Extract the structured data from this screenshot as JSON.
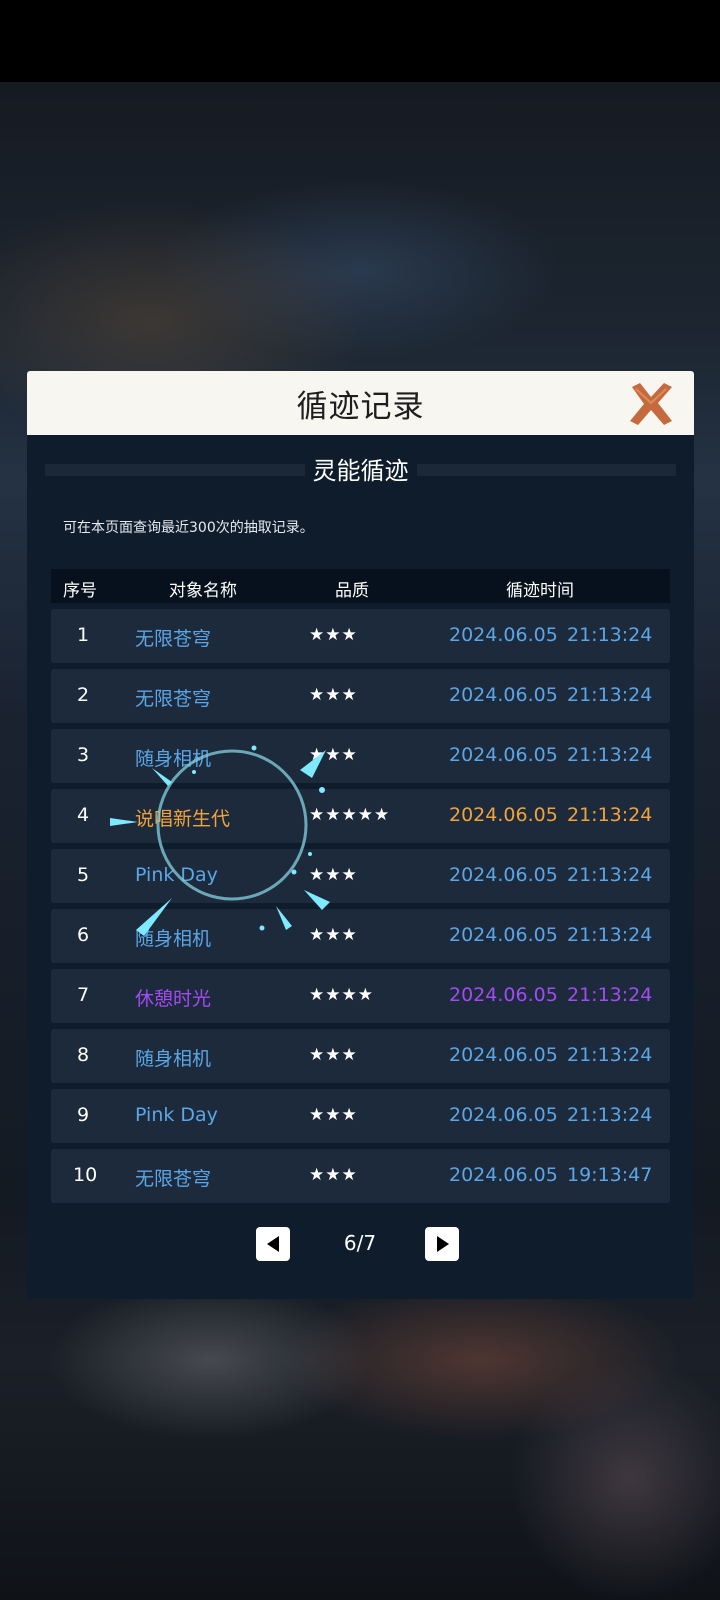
{
  "dialog": {
    "title": "循迹记录",
    "subtitle": "灵能循迹",
    "note": "可在本页面查询最近300次的抽取记录。"
  },
  "table": {
    "headers": {
      "no": "序号",
      "name": "对象名称",
      "quality": "品质",
      "time": "循迹时间"
    },
    "rows": [
      {
        "no": "1",
        "name": "无限苍穹",
        "stars": "★★★",
        "date": "2024.06.05",
        "time": "21:13:24",
        "color": "#5ba6e6"
      },
      {
        "no": "2",
        "name": "无限苍穹",
        "stars": "★★★",
        "date": "2024.06.05",
        "time": "21:13:24",
        "color": "#5ba6e6"
      },
      {
        "no": "3",
        "name": "随身相机",
        "stars": "★★★",
        "date": "2024.06.05",
        "time": "21:13:24",
        "color": "#5ba6e6"
      },
      {
        "no": "4",
        "name": "说唱新生代",
        "stars": "★★★★★",
        "date": "2024.06.05",
        "time": "21:13:24",
        "color": "#f2a33a"
      },
      {
        "no": "5",
        "name": "Pink Day",
        "stars": "★★★",
        "date": "2024.06.05",
        "time": "21:13:24",
        "color": "#5ba6e6"
      },
      {
        "no": "6",
        "name": "随身相机",
        "stars": "★★★",
        "date": "2024.06.05",
        "time": "21:13:24",
        "color": "#5ba6e6"
      },
      {
        "no": "7",
        "name": "休憩时光",
        "stars": "★★★★",
        "date": "2024.06.05",
        "time": "21:13:24",
        "color": "#a24bf2"
      },
      {
        "no": "8",
        "name": "随身相机",
        "stars": "★★★",
        "date": "2024.06.05",
        "time": "21:13:24",
        "color": "#5ba6e6"
      },
      {
        "no": "9",
        "name": "Pink Day",
        "stars": "★★★",
        "date": "2024.06.05",
        "time": "21:13:24",
        "color": "#5ba6e6"
      },
      {
        "no": "10",
        "name": "无限苍穹",
        "stars": "★★★",
        "date": "2024.06.05",
        "time": "19:13:47",
        "color": "#5ba6e6"
      }
    ]
  },
  "pager": {
    "label": "6/7",
    "prev_icon": "triangle-left-icon",
    "next_icon": "triangle-right-icon"
  },
  "icons": {
    "close": "close-x-icon"
  }
}
